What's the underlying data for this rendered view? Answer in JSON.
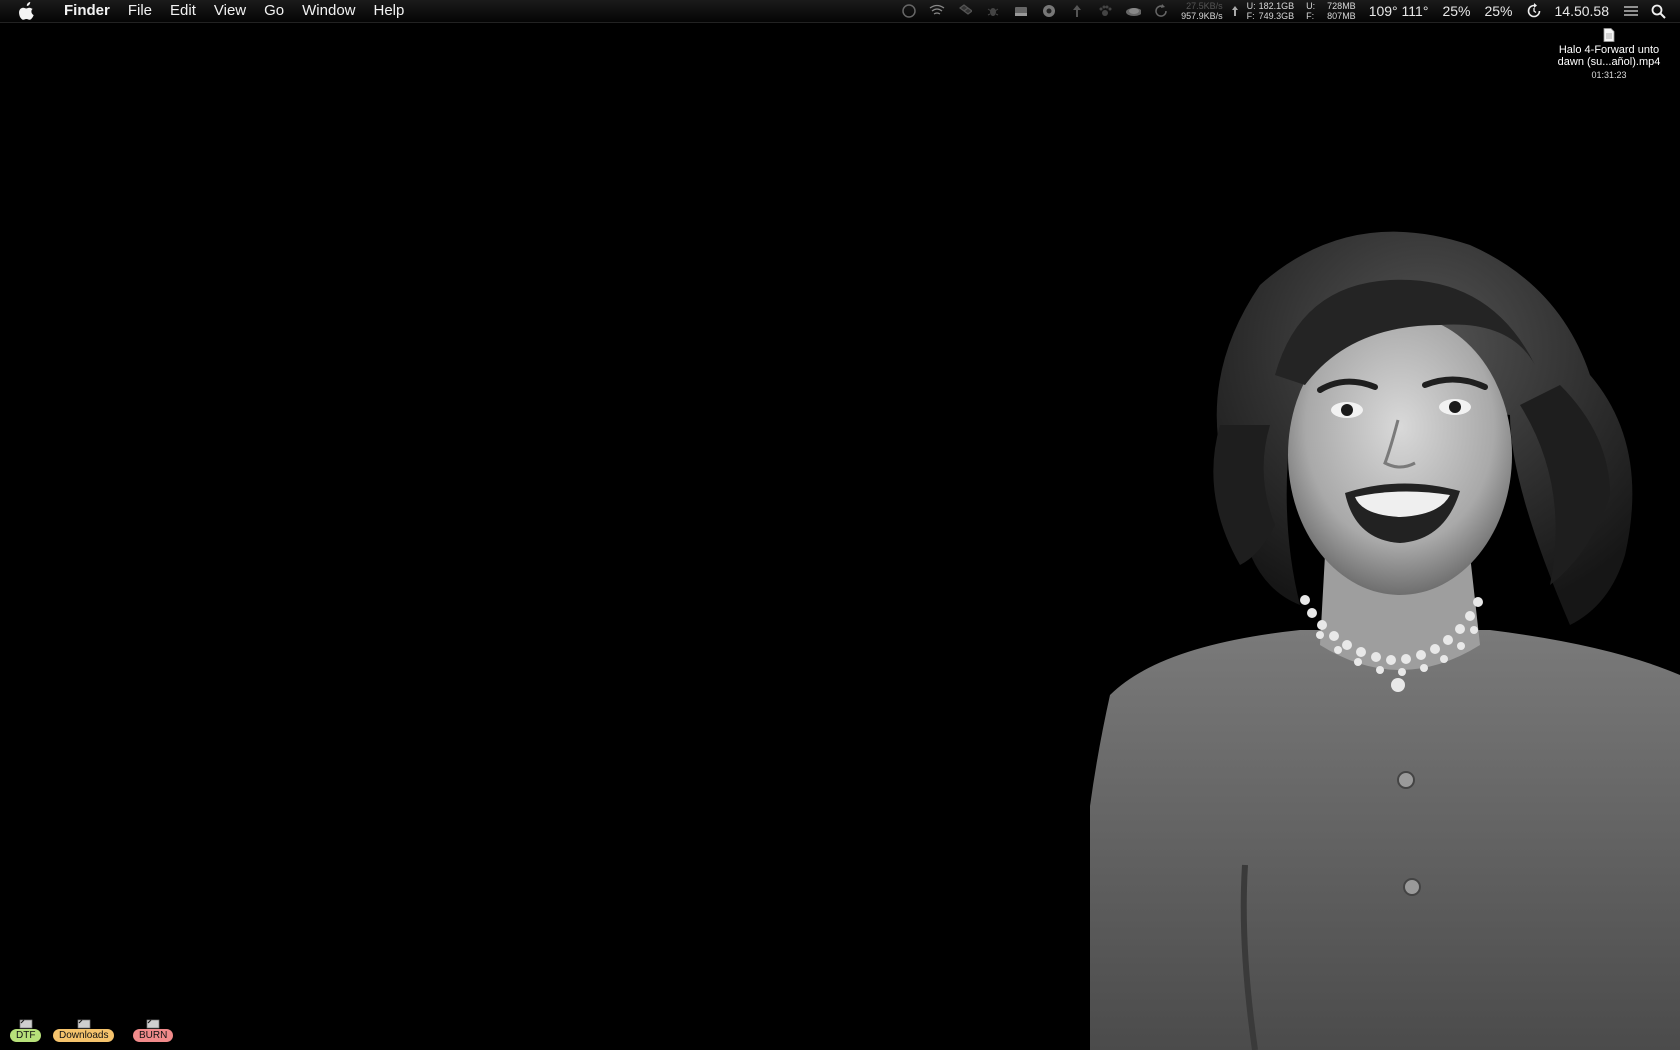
{
  "menubar": {
    "apple_icon": "apple-logo-icon",
    "app_name": "Finder",
    "items": [
      "File",
      "Edit",
      "View",
      "Go",
      "Window",
      "Help"
    ]
  },
  "status": {
    "icons": [
      "activity-circle-icon",
      "wifi-scanner-icon",
      "dropbox-icon",
      "bug-icon",
      "drive-icon",
      "webcam-icon",
      "upload-arrow-icon",
      "paw-icon",
      "cloud-icon",
      "sync-icon"
    ],
    "network": {
      "up": "27.5KB/s",
      "down": "957.9KB/s"
    },
    "disk": {
      "used_label": "U:",
      "used": "182.1GB",
      "free_label": "F:",
      "free": "749.3GB"
    },
    "memory": {
      "used_label": "U:",
      "used": "728MB",
      "free_label": "F:",
      "free": "807MB"
    },
    "temperatures": "109° 111°",
    "cpu1": "25%",
    "cpu2": "25%",
    "clock": "14.50.58"
  },
  "desktop_file": {
    "icon": "document-icon",
    "name_line1": "Halo 4-Forward unto",
    "name_line2": "dawn (su...añol).mp4",
    "duration": "01:31:23"
  },
  "aliases": [
    {
      "label": "DTF",
      "color": "#b7e07a"
    },
    {
      "label": "Downloads",
      "color": "#f5c36c"
    },
    {
      "label": "BURN",
      "color": "#f08a8a"
    }
  ],
  "wallpaper": {
    "description_icon": "vintage-portrait-photo"
  }
}
